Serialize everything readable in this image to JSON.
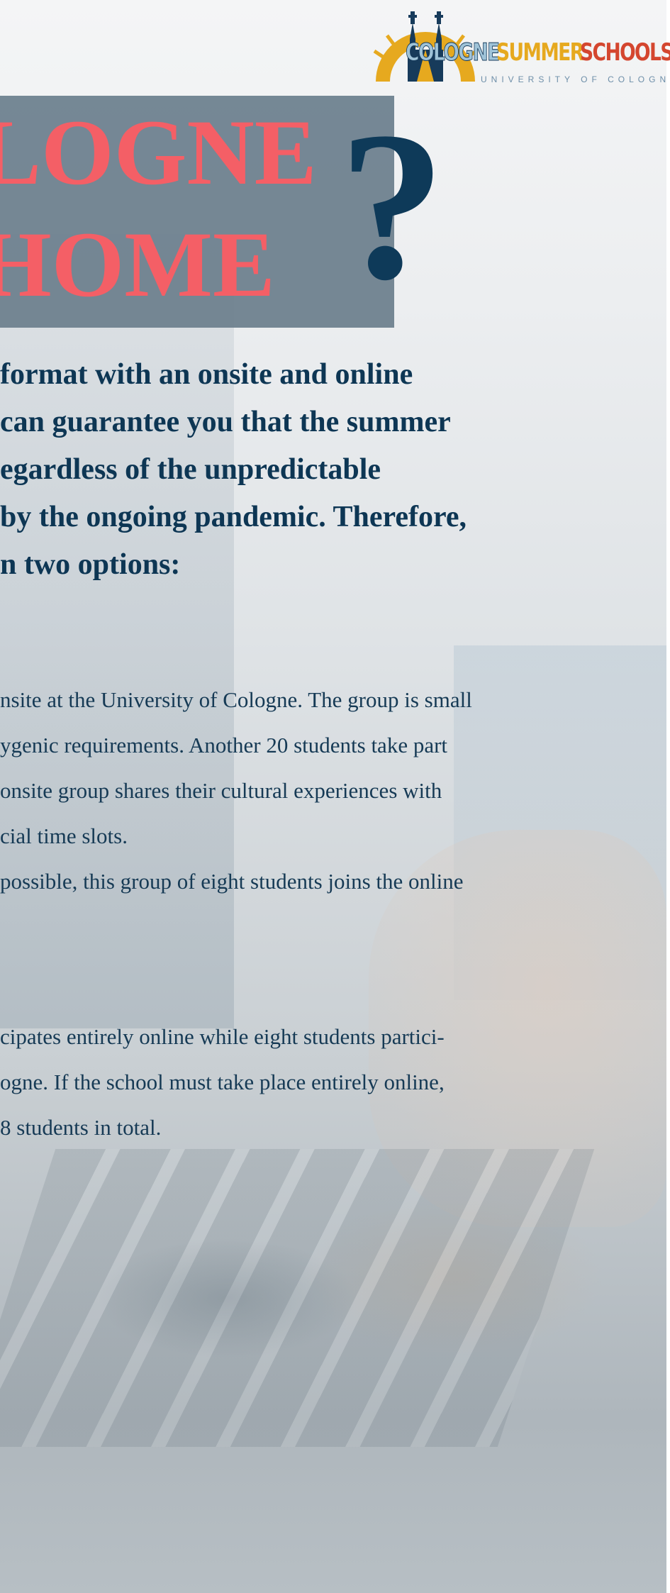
{
  "logo": {
    "word1": "COLOGNE",
    "word2": "SUMMER",
    "word3": "SCHOOLS",
    "subtitle": "UNIVERSITY OF COLOGNE",
    "colors": {
      "cologne": "#9fc3d8",
      "summer": "#e6a91f",
      "schools": "#d4462f",
      "navy": "#173b5b"
    }
  },
  "title": {
    "line1": "LOGNE",
    "line2": "HOME",
    "qmark": "?",
    "colors": {
      "text": "#f45f66",
      "panel": "#6c7f8d",
      "qmark": "#0e3a59"
    }
  },
  "intro_lines": [
    " format with an onsite and online",
    "can guarantee you that the summer",
    "egardless of the unpredictable",
    "by the ongoing pandemic. Therefore,",
    "n two options:"
  ],
  "option_a_lines": [
    "nsite at the University of Cologne. The group is small",
    "ygenic requirements. Another 20 students take part",
    "onsite group shares their cultural experiences with",
    "cial time slots.",
    "possible, this group of eight students joins the online"
  ],
  "option_b_lines": [
    "cipates entirely online while eight students partici-",
    "ogne. If the school must take place entirely online,",
    "8 students in total."
  ]
}
